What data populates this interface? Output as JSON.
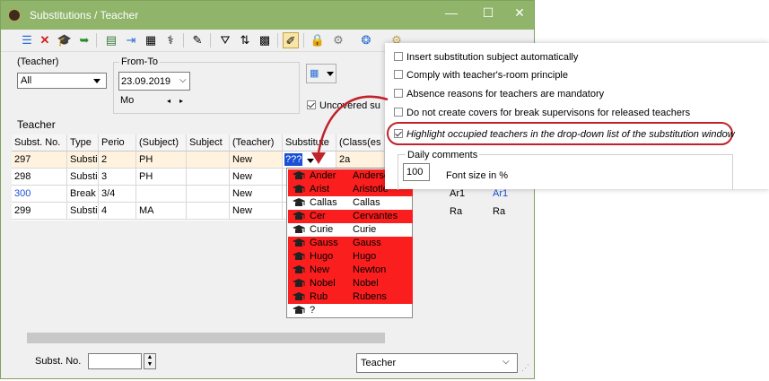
{
  "window": {
    "title": "Substitutions / Teacher",
    "controls": {
      "minimize": "—",
      "maximize": "☐",
      "close": "✕"
    }
  },
  "toolbar": {
    "icons": [
      "list-icon",
      "delete-icon",
      "teacher-cap-icon",
      "import-icon",
      "print-icon",
      "export-icon",
      "calculator-icon",
      "stethoscope-icon",
      "wand-icon",
      "filter-icon",
      "sort-icon",
      "grid-icon",
      "edit-icon",
      "lock-icon",
      "settings-icon",
      "help-icon",
      "gear-icon"
    ]
  },
  "filters": {
    "teacher_label": "(Teacher)",
    "teacher_value": "All",
    "from_to_label": "From-To",
    "date_value": "23.09.2019",
    "weekday": "Mo",
    "uncovered_label": "Uncovered su",
    "section_label": "Teacher"
  },
  "table": {
    "columns": [
      "Subst. No.",
      "Type",
      "Perio",
      "(Subject)",
      "Subject",
      "(Teacher)",
      "Substitute",
      "(Class(es"
    ],
    "rows": [
      {
        "no": "297",
        "type": "Substi",
        "period": "2",
        "subj_orig": "PH",
        "subject": "",
        "teacher": "New",
        "substitute": "???",
        "classes": "2a"
      },
      {
        "no": "298",
        "type": "Substi",
        "period": "3",
        "subj_orig": "PH",
        "subject": "",
        "teacher": "New",
        "substitute": "",
        "classes": ""
      },
      {
        "no": "300",
        "type": "Break",
        "period": "3/4",
        "subj_orig": "",
        "subject": "",
        "teacher": "New",
        "substitute": "",
        "classes": ""
      },
      {
        "no": "299",
        "type": "Substi",
        "period": "4",
        "subj_orig": "MA",
        "subject": "",
        "teacher": "New",
        "substitute": "",
        "classes": ""
      }
    ],
    "extra_cells": [
      [
        "Ar1",
        "Ar1"
      ],
      [
        "Ra",
        "Ra"
      ]
    ]
  },
  "dropdown": {
    "items": [
      {
        "short": "Ander",
        "long": "Andersen",
        "occupied": true
      },
      {
        "short": "Arist",
        "long": "Aristotle",
        "occupied": true
      },
      {
        "short": "Callas",
        "long": "Callas",
        "occupied": false
      },
      {
        "short": "Cer",
        "long": "Cervantes",
        "occupied": true
      },
      {
        "short": "Curie",
        "long": "Curie",
        "occupied": false
      },
      {
        "short": "Gauss",
        "long": "Gauss",
        "occupied": true
      },
      {
        "short": "Hugo",
        "long": "Hugo",
        "occupied": true
      },
      {
        "short": "New",
        "long": "Newton",
        "occupied": true
      },
      {
        "short": "Nobel",
        "long": "Nobel",
        "occupied": true
      },
      {
        "short": "Rub",
        "long": "Rubens",
        "occupied": true
      },
      {
        "short": "?",
        "long": "",
        "occupied": false
      }
    ],
    "colors": {
      "occupied": "#fa1e1e"
    }
  },
  "settings": {
    "options": [
      {
        "label": "Insert substitution subject automatically",
        "checked": false
      },
      {
        "label": "Comply with teacher's-room principle",
        "checked": false
      },
      {
        "label": "Absence reasons for teachers are mandatory",
        "checked": false
      },
      {
        "label": "Do not create covers for break supervisons for released teachers",
        "checked": false
      },
      {
        "label": "Highlight occupied teachers in the drop-down list of the substitution window",
        "checked": true
      }
    ],
    "daily_comments_label": "Daily comments",
    "font_size_value": "100",
    "font_size_label": "Font size in %",
    "highlight_color": "#c0232a"
  },
  "footer": {
    "subst_no_label": "Subst. No.",
    "subst_no_value": "",
    "view_select": "Teacher"
  },
  "colors": {
    "titlebar": "#8fb46a",
    "selected_row": "#fff3e0",
    "link_blue": "#1a4fd6"
  }
}
